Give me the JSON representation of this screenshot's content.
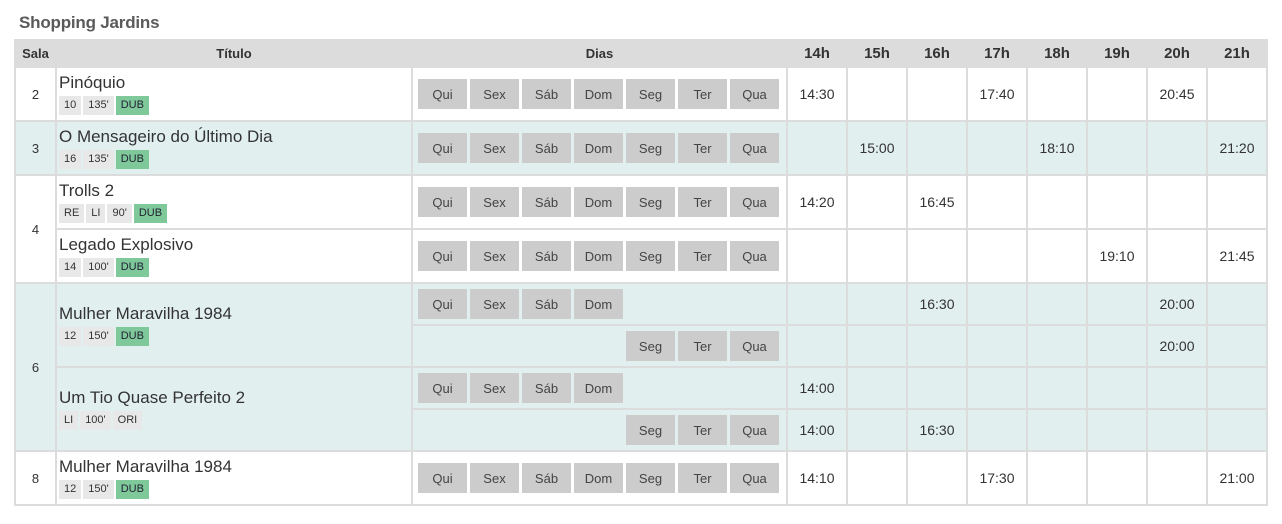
{
  "cinema": "Shopping Jardins",
  "headers": {
    "sala": "Sala",
    "titulo": "Título",
    "dias": "Dias"
  },
  "hours": [
    "14h",
    "15h",
    "16h",
    "17h",
    "18h",
    "19h",
    "20h",
    "21h"
  ],
  "day_labels": [
    "Qui",
    "Sex",
    "Sáb",
    "Dom",
    "Seg",
    "Ter",
    "Qua"
  ],
  "rows": [
    {
      "sala": "2",
      "title": "Pinóquio",
      "badges": [
        "10",
        "135'",
        "DUB"
      ],
      "times": [
        "14:30",
        "",
        "",
        "17:40",
        "",
        "",
        "20:45",
        ""
      ]
    },
    {
      "sala": "3",
      "title": "O Mensageiro do Último Dia",
      "badges": [
        "16",
        "135'",
        "DUB"
      ],
      "times": [
        "",
        "15:00",
        "",
        "",
        "18:10",
        "",
        "",
        "21:20"
      ]
    },
    {
      "sala": "4",
      "title": "Trolls 2",
      "badges": [
        "RE",
        "LI",
        "90'",
        "DUB"
      ],
      "times": [
        "14:20",
        "",
        "16:45",
        "",
        "",
        "",
        "",
        ""
      ]
    },
    {
      "title": "Legado Explosivo",
      "badges": [
        "14",
        "100'",
        "DUB"
      ],
      "times": [
        "",
        "",
        "",
        "",
        "",
        "19:10",
        "",
        "21:45"
      ]
    },
    {
      "sala": "6",
      "title": "Mulher Maravilha 1984",
      "badges": [
        "12",
        "150'",
        "DUB"
      ],
      "sub": [
        {
          "times": [
            "",
            "",
            "16:30",
            "",
            "",
            "",
            "20:00",
            ""
          ]
        },
        {
          "times": [
            "",
            "",
            "",
            "",
            "",
            "",
            "20:00",
            ""
          ]
        }
      ]
    },
    {
      "title": "Um Tio Quase Perfeito 2",
      "badges": [
        "LI",
        "100'",
        "ORI"
      ],
      "sub": [
        {
          "times": [
            "14:00",
            "",
            "",
            "",
            "",
            "",
            "",
            ""
          ]
        },
        {
          "times": [
            "14:00",
            "",
            "16:30",
            "",
            "",
            "",
            "",
            ""
          ]
        }
      ]
    },
    {
      "sala": "8",
      "title": "Mulher Maravilha 1984",
      "badges": [
        "12",
        "150'",
        "DUB"
      ],
      "times": [
        "14:10",
        "",
        "",
        "17:30",
        "",
        "",
        "",
        "21:00"
      ]
    }
  ],
  "colors": {
    "header_bg": "#dcdcdc",
    "row_shade": "#e2efef",
    "day_button": "#cccccc",
    "dub_badge": "#7ec89a"
  }
}
